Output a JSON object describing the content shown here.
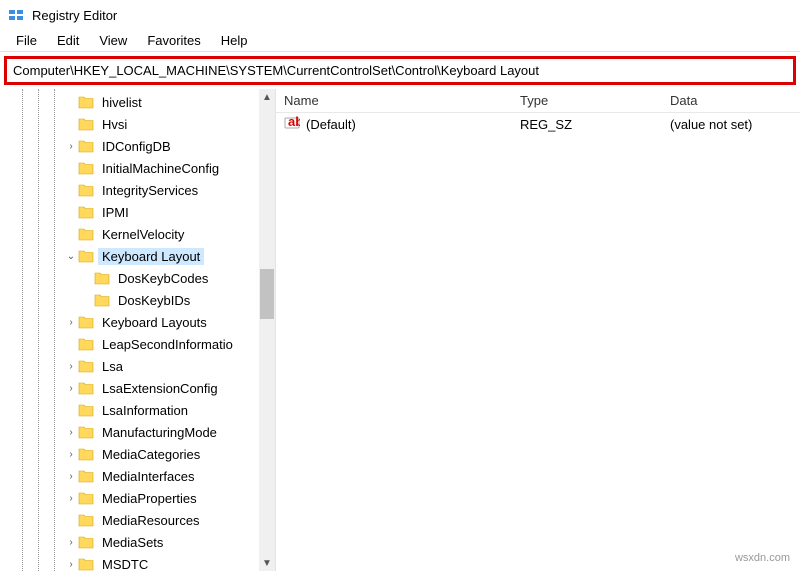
{
  "title": "Registry Editor",
  "menubar": [
    "File",
    "Edit",
    "View",
    "Favorites",
    "Help"
  ],
  "addressbar": "Computer\\HKEY_LOCAL_MACHINE\\SYSTEM\\CurrentControlSet\\Control\\Keyboard Layout",
  "tree": [
    {
      "label": "hivelist",
      "indent": 3,
      "expand": ""
    },
    {
      "label": "Hvsi",
      "indent": 3,
      "expand": ""
    },
    {
      "label": "IDConfigDB",
      "indent": 3,
      "expand": ">"
    },
    {
      "label": "InitialMachineConfig",
      "indent": 3,
      "expand": ""
    },
    {
      "label": "IntegrityServices",
      "indent": 3,
      "expand": ""
    },
    {
      "label": "IPMI",
      "indent": 3,
      "expand": ""
    },
    {
      "label": "KernelVelocity",
      "indent": 3,
      "expand": ""
    },
    {
      "label": "Keyboard Layout",
      "indent": 3,
      "expand": "v",
      "selected": true
    },
    {
      "label": "DosKeybCodes",
      "indent": 4,
      "expand": ""
    },
    {
      "label": "DosKeybIDs",
      "indent": 4,
      "expand": ""
    },
    {
      "label": "Keyboard Layouts",
      "indent": 3,
      "expand": ">"
    },
    {
      "label": "LeapSecondInformatio",
      "indent": 3,
      "expand": ""
    },
    {
      "label": "Lsa",
      "indent": 3,
      "expand": ">"
    },
    {
      "label": "LsaExtensionConfig",
      "indent": 3,
      "expand": ">"
    },
    {
      "label": "LsaInformation",
      "indent": 3,
      "expand": ""
    },
    {
      "label": "ManufacturingMode",
      "indent": 3,
      "expand": ">"
    },
    {
      "label": "MediaCategories",
      "indent": 3,
      "expand": ">"
    },
    {
      "label": "MediaInterfaces",
      "indent": 3,
      "expand": ">"
    },
    {
      "label": "MediaProperties",
      "indent": 3,
      "expand": ">"
    },
    {
      "label": "MediaResources",
      "indent": 3,
      "expand": ""
    },
    {
      "label": "MediaSets",
      "indent": 3,
      "expand": ">"
    },
    {
      "label": "MSDTC",
      "indent": 3,
      "expand": ">"
    }
  ],
  "list": {
    "columns": {
      "name": "Name",
      "type": "Type",
      "data": "Data"
    },
    "rows": [
      {
        "name": "(Default)",
        "type": "REG_SZ",
        "data": "(value not set)"
      }
    ]
  },
  "watermark": "wsxdn.com"
}
